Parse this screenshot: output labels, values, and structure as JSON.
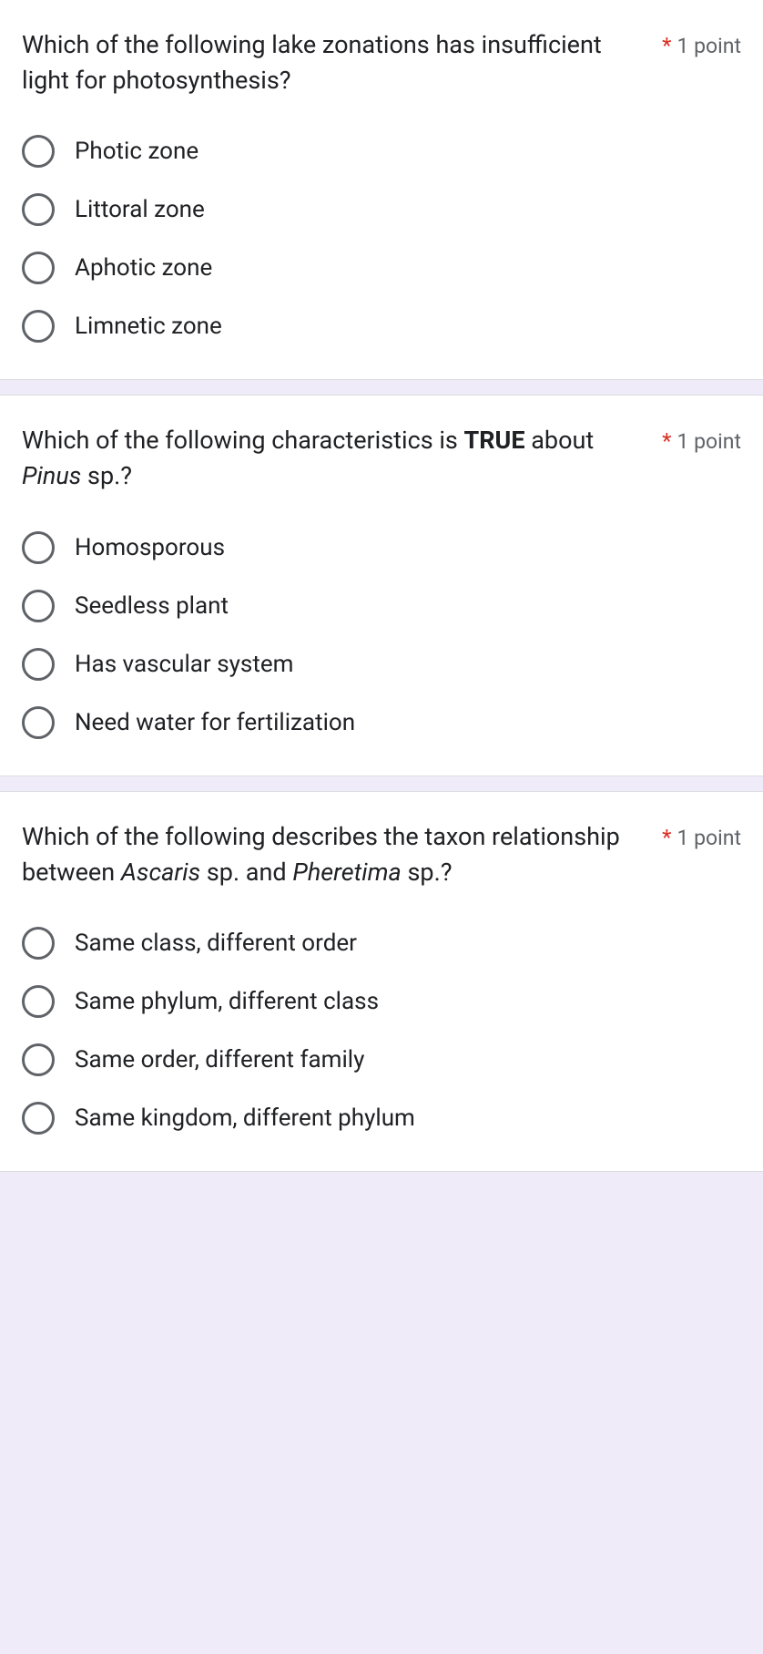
{
  "points_label": "1 point",
  "required_mark": "*",
  "questions": [
    {
      "text_html": "Which of the following lake zonations has insufficient light for photosynthesis?",
      "options": [
        "Photic zone",
        "Littoral zone",
        "Aphotic zone",
        "Limnetic zone"
      ]
    },
    {
      "text_html": "Which of the following characteristics is <b>TRUE</b> about <i>Pinus</i> sp.?",
      "options": [
        "Homosporous",
        "Seedless plant",
        "Has vascular system",
        "Need water for fertilization"
      ]
    },
    {
      "text_html": "Which of the following describes the taxon relationship between <i>Ascaris</i> sp. and <i>Pheretima</i> sp.?",
      "options": [
        "Same class, different order",
        "Same phylum, different class",
        "Same order, different family",
        "Same kingdom, different phylum"
      ]
    }
  ]
}
